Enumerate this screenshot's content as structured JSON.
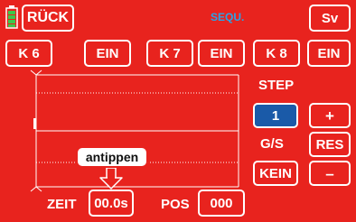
{
  "header": {
    "back_label": "RÜCK",
    "title": "SEQU.",
    "title_color": "#29a3e8",
    "save_label": "Sv"
  },
  "channel_row": {
    "items": [
      {
        "channel": "K 6",
        "state": "EIN"
      },
      {
        "channel": "K 7",
        "state": "EIN"
      },
      {
        "channel": "K 8",
        "state": "EIN"
      }
    ]
  },
  "step_panel": {
    "step_label": "STEP",
    "step_value": "1",
    "plus_label": "+",
    "gs_label": "G/S",
    "res_label": "RES",
    "gs_value": "KEIN",
    "minus_label": "–"
  },
  "footer": {
    "zeit_label": "ZEIT",
    "zeit_value": "00.0s",
    "pos_label": "POS",
    "pos_value": "000"
  },
  "callout": {
    "text": "antippen"
  },
  "colors": {
    "background": "#e8231e",
    "selected": "#1a5aa8",
    "battery": "#3cc84a",
    "arrow": "#e8231e"
  },
  "icons": {
    "battery": "battery-icon",
    "arrow": "arrow-down-icon"
  }
}
